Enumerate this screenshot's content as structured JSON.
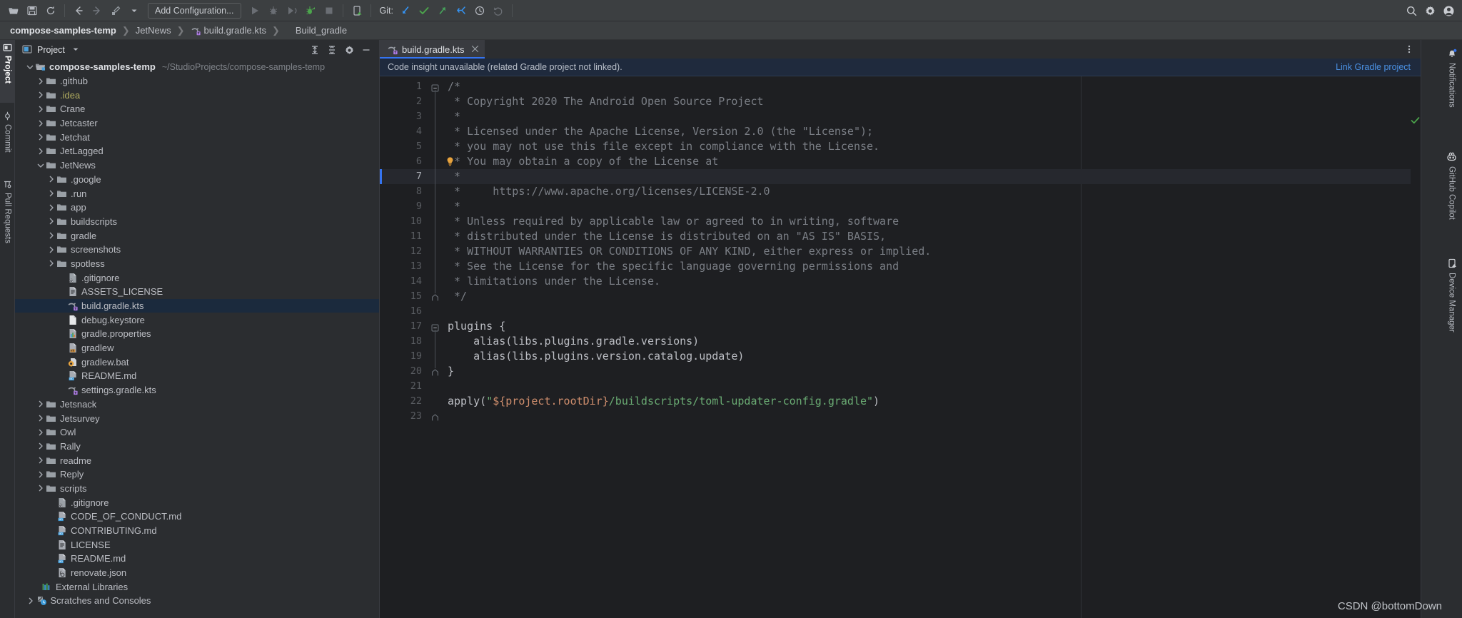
{
  "toolbar": {
    "icons": [
      "open-folder-icon",
      "save-icon",
      "sync-icon",
      "back-arrow-icon",
      "forward-arrow-icon",
      "build-icon",
      "dropdown-caret-icon"
    ],
    "run_config_label": "Add Configuration...",
    "run_icon": "run-icon",
    "debug_icon": "debug-icon",
    "run_coverage_icon": "run-with-coverage-icon",
    "profile_icon": "profile-icon",
    "stop_icon": "stop-icon",
    "device_icon": "device-picker-icon",
    "git_label": "Git:",
    "git_icons": [
      "git-update-icon",
      "git-commit-icon",
      "git-push-icon",
      "git-rebase-icon",
      "git-history-icon",
      "git-rollback-icon"
    ],
    "right_icons": [
      "search-icon",
      "gear-icon",
      "account-icon"
    ]
  },
  "breadcrumb": {
    "items": [
      {
        "label": "compose-samples-temp",
        "icon": null
      },
      {
        "label": "JetNews",
        "icon": null
      },
      {
        "label": "build.gradle.kts",
        "icon": "gradle-kts-icon"
      },
      {
        "label": "Build_gradle",
        "icon": null
      }
    ],
    "separator": "❯"
  },
  "left_stripe": {
    "tabs": [
      {
        "label": "Project",
        "icon": "project-icon",
        "active": true
      },
      {
        "label": "Commit",
        "icon": "commit-icon",
        "active": false
      },
      {
        "label": "Pull Requests",
        "icon": "pull-request-icon",
        "active": false
      }
    ]
  },
  "right_stripe": {
    "tabs": [
      {
        "label": "Notifications",
        "icon": "bell-icon",
        "badge": true
      },
      {
        "label": "GitHub Copilot",
        "icon": "copilot-icon",
        "badge": false
      },
      {
        "label": "Device Manager",
        "icon": "device-manager-icon",
        "badge": false
      }
    ]
  },
  "project_panel": {
    "title": "Project",
    "panel_icon": "project-window-icon",
    "caret_icon": "chevron-down-icon",
    "actions": [
      "expand-all-icon",
      "collapse-all-icon",
      "settings-gear-icon",
      "hide-panel-icon"
    ],
    "tree": [
      {
        "indent": 0,
        "arrow": "down",
        "icon": "project-root-icon",
        "label": "compose-samples-temp",
        "bold": true,
        "path": "~/StudioProjects/compose-samples-temp"
      },
      {
        "indent": 1,
        "arrow": "right",
        "icon": "folder-icon",
        "label": ".github"
      },
      {
        "indent": 1,
        "arrow": "right",
        "icon": "folder-icon",
        "label": ".idea",
        "color": "yellow"
      },
      {
        "indent": 1,
        "arrow": "right",
        "icon": "folder-icon",
        "label": "Crane"
      },
      {
        "indent": 1,
        "arrow": "right",
        "icon": "folder-icon",
        "label": "Jetcaster"
      },
      {
        "indent": 1,
        "arrow": "right",
        "icon": "folder-icon",
        "label": "Jetchat"
      },
      {
        "indent": 1,
        "arrow": "right",
        "icon": "folder-icon",
        "label": "JetLagged"
      },
      {
        "indent": 1,
        "arrow": "down",
        "icon": "folder-icon",
        "label": "JetNews"
      },
      {
        "indent": 2,
        "arrow": "right",
        "icon": "folder-icon",
        "label": ".google"
      },
      {
        "indent": 2,
        "arrow": "right",
        "icon": "folder-icon",
        "label": ".run"
      },
      {
        "indent": 2,
        "arrow": "right",
        "icon": "folder-icon",
        "label": "app"
      },
      {
        "indent": 2,
        "arrow": "right",
        "icon": "folder-icon",
        "label": "buildscripts"
      },
      {
        "indent": 2,
        "arrow": "right",
        "icon": "folder-icon",
        "label": "gradle"
      },
      {
        "indent": 2,
        "arrow": "right",
        "icon": "folder-icon",
        "label": "screenshots"
      },
      {
        "indent": 2,
        "arrow": "right",
        "icon": "folder-icon",
        "label": "spotless"
      },
      {
        "indent": 3,
        "arrow": "none",
        "icon": "gitignore-icon",
        "label": ".gitignore"
      },
      {
        "indent": 3,
        "arrow": "none",
        "icon": "text-file-icon",
        "label": "ASSETS_LICENSE"
      },
      {
        "indent": 3,
        "arrow": "none",
        "icon": "gradle-kts-icon",
        "label": "build.gradle.kts",
        "selected": true
      },
      {
        "indent": 3,
        "arrow": "none",
        "icon": "blank-file-icon",
        "label": "debug.keystore"
      },
      {
        "indent": 3,
        "arrow": "none",
        "icon": "properties-icon",
        "label": "gradle.properties"
      },
      {
        "indent": 3,
        "arrow": "none",
        "icon": "shell-script-icon",
        "label": "gradlew"
      },
      {
        "indent": 3,
        "arrow": "none",
        "icon": "bat-file-icon",
        "label": "gradlew.bat"
      },
      {
        "indent": 3,
        "arrow": "none",
        "icon": "markdown-icon",
        "label": "README.md"
      },
      {
        "indent": 3,
        "arrow": "none",
        "icon": "gradle-kts-icon",
        "label": "settings.gradle.kts"
      },
      {
        "indent": 1,
        "arrow": "right",
        "icon": "folder-icon",
        "label": "Jetsnack"
      },
      {
        "indent": 1,
        "arrow": "right",
        "icon": "folder-icon",
        "label": "Jetsurvey"
      },
      {
        "indent": 1,
        "arrow": "right",
        "icon": "folder-icon",
        "label": "Owl"
      },
      {
        "indent": 1,
        "arrow": "right",
        "icon": "folder-icon",
        "label": "Rally"
      },
      {
        "indent": 1,
        "arrow": "right",
        "icon": "folder-icon",
        "label": "readme"
      },
      {
        "indent": 1,
        "arrow": "right",
        "icon": "folder-icon",
        "label": "Reply"
      },
      {
        "indent": 1,
        "arrow": "right",
        "icon": "folder-icon",
        "label": "scripts"
      },
      {
        "indent": 2,
        "arrow": "none",
        "icon": "gitignore-icon",
        "label": ".gitignore"
      },
      {
        "indent": 2,
        "arrow": "none",
        "icon": "markdown-icon",
        "label": "CODE_OF_CONDUCT.md"
      },
      {
        "indent": 2,
        "arrow": "none",
        "icon": "markdown-icon",
        "label": "CONTRIBUTING.md"
      },
      {
        "indent": 2,
        "arrow": "none",
        "icon": "text-file-icon",
        "label": "LICENSE"
      },
      {
        "indent": 2,
        "arrow": "none",
        "icon": "markdown-icon",
        "label": "README.md"
      },
      {
        "indent": 2,
        "arrow": "none",
        "icon": "json-file-icon",
        "label": "renovate.json"
      },
      {
        "indent": 0.6,
        "arrow": "none",
        "icon": "external-libraries-icon",
        "label": "External Libraries"
      },
      {
        "indent": 0.1,
        "arrow": "right",
        "icon": "scratches-icon",
        "label": "Scratches and Consoles"
      }
    ]
  },
  "editor": {
    "tab": {
      "label": "build.gradle.kts",
      "icon": "gradle-kts-icon",
      "close_icon": "close-icon"
    },
    "tab_menu_icon": "more-options-icon",
    "notification": {
      "message": "Code insight unavailable (related Gradle project not linked).",
      "link": "Link Gradle project"
    },
    "inspection_status_icon": "checkmark-ok-icon",
    "current_line": 7,
    "lines": [
      {
        "n": 1,
        "tokens": [
          {
            "t": "/*",
            "c": "c-comment"
          }
        ],
        "fold": "start"
      },
      {
        "n": 2,
        "tokens": [
          {
            "t": " * Copyright 2020 The Android Open Source Project",
            "c": "c-comment"
          }
        ]
      },
      {
        "n": 3,
        "tokens": [
          {
            "t": " *",
            "c": "c-comment"
          }
        ]
      },
      {
        "n": 4,
        "tokens": [
          {
            "t": " * Licensed under the Apache License, Version 2.0 (the \"License\");",
            "c": "c-comment"
          }
        ]
      },
      {
        "n": 5,
        "tokens": [
          {
            "t": " * you may not use this file except in compliance with the License.",
            "c": "c-comment"
          }
        ]
      },
      {
        "n": 6,
        "tokens": [
          {
            "t": " * You may obtain a copy of the License at",
            "c": "c-comment"
          }
        ],
        "bulb": true
      },
      {
        "n": 7,
        "tokens": [
          {
            "t": " *",
            "c": "c-comment"
          }
        ],
        "current": true
      },
      {
        "n": 8,
        "tokens": [
          {
            "t": " *     https://www.apache.org/licenses/LICENSE-2.0",
            "c": "c-comment"
          }
        ]
      },
      {
        "n": 9,
        "tokens": [
          {
            "t": " *",
            "c": "c-comment"
          }
        ]
      },
      {
        "n": 10,
        "tokens": [
          {
            "t": " * Unless required by applicable law or agreed to in writing, software",
            "c": "c-comment"
          }
        ]
      },
      {
        "n": 11,
        "tokens": [
          {
            "t": " * distributed under the License is distributed on an \"AS IS\" BASIS,",
            "c": "c-comment"
          }
        ]
      },
      {
        "n": 12,
        "tokens": [
          {
            "t": " * WITHOUT WARRANTIES OR CONDITIONS OF ANY KIND, either express or implied.",
            "c": "c-comment"
          }
        ]
      },
      {
        "n": 13,
        "tokens": [
          {
            "t": " * See the License for the specific language governing permissions and",
            "c": "c-comment"
          }
        ]
      },
      {
        "n": 14,
        "tokens": [
          {
            "t": " * limitations under the License.",
            "c": "c-comment"
          }
        ]
      },
      {
        "n": 15,
        "tokens": [
          {
            "t": " */",
            "c": "c-comment"
          }
        ],
        "fold": "end"
      },
      {
        "n": 16,
        "tokens": []
      },
      {
        "n": 17,
        "tokens": [
          {
            "t": "plugins {",
            "c": "c-prop"
          }
        ],
        "fold": "start"
      },
      {
        "n": 18,
        "tokens": [
          {
            "t": "    alias(libs.plugins.gradle.versions)",
            "c": "c-prop"
          }
        ]
      },
      {
        "n": 19,
        "tokens": [
          {
            "t": "    alias(libs.plugins.version.catalog.update)",
            "c": "c-prop"
          }
        ]
      },
      {
        "n": 20,
        "tokens": [
          {
            "t": "}",
            "c": "c-prop"
          }
        ],
        "fold": "end"
      },
      {
        "n": 21,
        "tokens": []
      },
      {
        "n": 22,
        "tokens": [
          {
            "t": "apply(",
            "c": "c-prop"
          },
          {
            "t": "\"",
            "c": "c-str"
          },
          {
            "t": "${project.rootDir}",
            "c": "c-tmpl"
          },
          {
            "t": "/buildscripts/toml-updater-config.gradle\"",
            "c": "c-str"
          },
          {
            "t": ")",
            "c": "c-prop"
          }
        ]
      },
      {
        "n": 23,
        "tokens": [],
        "fold": "end"
      }
    ]
  },
  "watermark": "CSDN @bottomDown",
  "colors": {
    "accent_blue": "#3574f0",
    "link_blue": "#4a90e2",
    "selection_bg": "#1b2a3d",
    "editor_bg": "#1e1f22",
    "panel_bg": "#2b2d30",
    "toolbar_bg": "#3c3f41",
    "comment_gray": "#7a7e85",
    "string_green": "#6aab73",
    "template_orange": "#cf8e6d",
    "folder_gray": "#9aa0a6",
    "ok_green": "#4ca64c"
  }
}
